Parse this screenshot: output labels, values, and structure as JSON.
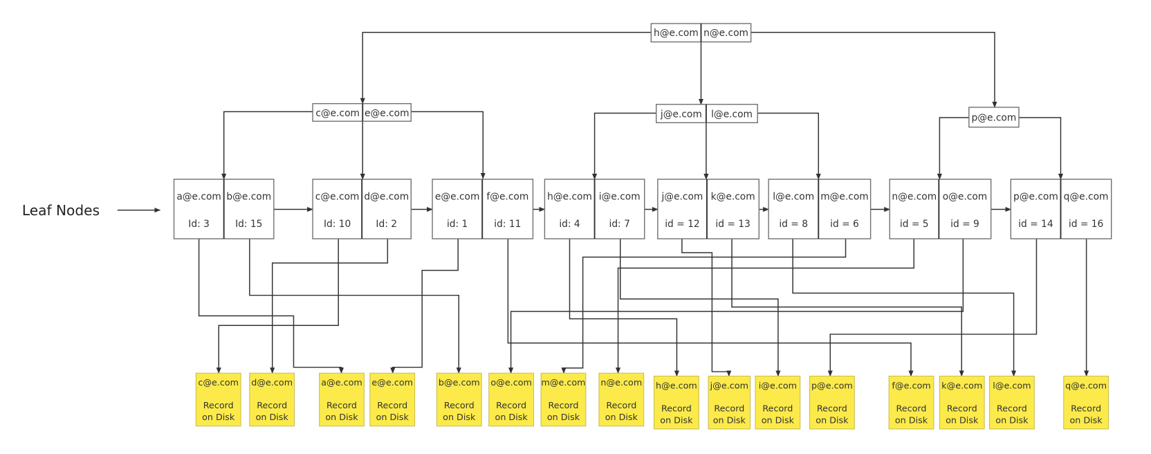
{
  "leaf_label": "Leaf Nodes",
  "root": {
    "keys": [
      "h@e.com",
      "n@e.com"
    ]
  },
  "internal": [
    {
      "keys": [
        "c@e.com",
        "e@e.com"
      ]
    },
    {
      "keys": [
        "j@e.com",
        "l@e.com"
      ]
    },
    {
      "keys": [
        "p@e.com"
      ]
    }
  ],
  "leaves": [
    {
      "entries": [
        {
          "key": "a@e.com",
          "id": "Id: 3"
        },
        {
          "key": "b@e.com",
          "id": "Id: 15"
        }
      ]
    },
    {
      "entries": [
        {
          "key": "c@e.com",
          "id": "Id: 10"
        },
        {
          "key": "d@e.com",
          "id": "Id: 2"
        }
      ]
    },
    {
      "entries": [
        {
          "key": "e@e.com",
          "id": "id: 1"
        },
        {
          "key": "f@e.com",
          "id": "id: 11"
        }
      ]
    },
    {
      "entries": [
        {
          "key": "h@e.com",
          "id": "id: 4"
        },
        {
          "key": "i@e.com",
          "id": "id: 7"
        }
      ]
    },
    {
      "entries": [
        {
          "key": "j@e.com",
          "id": "id = 12"
        },
        {
          "key": "k@e.com",
          "id": "id = 13"
        }
      ]
    },
    {
      "entries": [
        {
          "key": "l@e.com",
          "id": "id = 8"
        },
        {
          "key": "m@e.com",
          "id": "id = 6"
        }
      ]
    },
    {
      "entries": [
        {
          "key": "n@e.com",
          "id": "id = 5"
        },
        {
          "key": "o@e.com",
          "id": "id = 9"
        }
      ]
    },
    {
      "entries": [
        {
          "key": "p@e.com",
          "id": "id = 14"
        },
        {
          "key": "q@e.com",
          "id": "id = 16"
        }
      ]
    }
  ],
  "records": [
    {
      "key": "c@e.com",
      "line1": "Record",
      "line2": "on Disk"
    },
    {
      "key": "d@e.com",
      "line1": "Record",
      "line2": "on Disk"
    },
    {
      "key": "a@e.com",
      "line1": "Record",
      "line2": "on Disk"
    },
    {
      "key": "e@e.com",
      "line1": "Record",
      "line2": "on Disk"
    },
    {
      "key": "b@e.com",
      "line1": "Record",
      "line2": "on Disk"
    },
    {
      "key": "o@e.com",
      "line1": "Record",
      "line2": "on Disk"
    },
    {
      "key": "m@e.com",
      "line1": "Record",
      "line2": "on Disk"
    },
    {
      "key": "n@e.com",
      "line1": "Record",
      "line2": "on Disk"
    },
    {
      "key": "h@e.com",
      "line1": "Record",
      "line2": "on Disk"
    },
    {
      "key": "j@e.com",
      "line1": "Record",
      "line2": "on Disk"
    },
    {
      "key": "i@e.com",
      "line1": "Record",
      "line2": "on Disk"
    },
    {
      "key": "p@e.com",
      "line1": "Record",
      "line2": "on Disk"
    },
    {
      "key": "f@e.com",
      "line1": "Record",
      "line2": "on Disk"
    },
    {
      "key": "k@e.com",
      "line1": "Record",
      "line2": "on Disk"
    },
    {
      "key": "l@e.com",
      "line1": "Record",
      "line2": "on Disk"
    },
    {
      "key": "q@e.com",
      "line1": "Record",
      "line2": "on Disk"
    }
  ],
  "colors": {
    "record_fill": "#fbea4a",
    "line": "#333333",
    "node_border": "#6e6e6e"
  }
}
